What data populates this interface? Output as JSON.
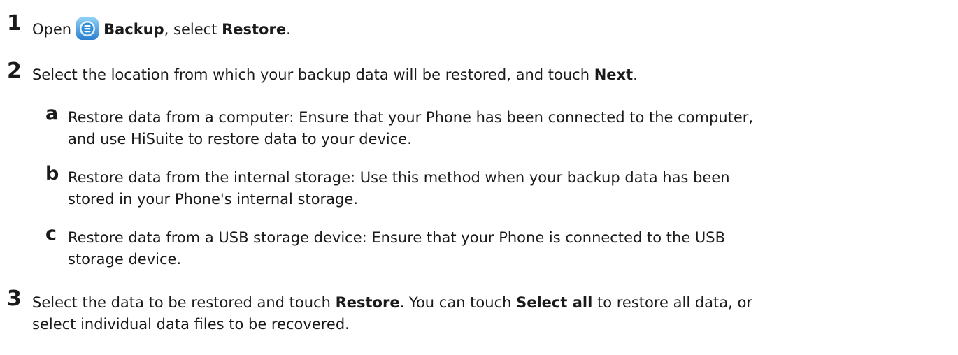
{
  "steps": {
    "s1": {
      "number": "1",
      "open": "Open",
      "app_name": "Backup",
      "mid": ", select ",
      "action": "Restore",
      "end": "."
    },
    "s2": {
      "number": "2",
      "text": "Select the location from which your backup data will be restored, and touch ",
      "action": "Next",
      "end": "."
    },
    "s2a": {
      "letter": "a",
      "line1": "Restore data from a computer: Ensure that your Phone has been connected to the computer,",
      "line2": "and use HiSuite to restore data to your device."
    },
    "s2b": {
      "letter": "b",
      "line1": "Restore data from the internal storage: Use this method when your backup data has been",
      "line2": "stored in your Phone's internal storage."
    },
    "s2c": {
      "letter": "c",
      "line1": "Restore data from a USB storage device: Ensure that your Phone is connected to the USB",
      "line2": "storage device."
    },
    "s3": {
      "number": "3",
      "pre": "Select the data to be restored and touch ",
      "action": "Restore",
      "mid": ". You can touch ",
      "action2": "Select all",
      "post": " to restore all data, or",
      "line2": "select individual data files to be recovered."
    }
  },
  "icons": {
    "backup_app": "backup-app-icon"
  },
  "colors": {
    "icon_blue": "#2f8fd8",
    "icon_dark": "#1e6fb5",
    "text": "#1a1a1a"
  }
}
